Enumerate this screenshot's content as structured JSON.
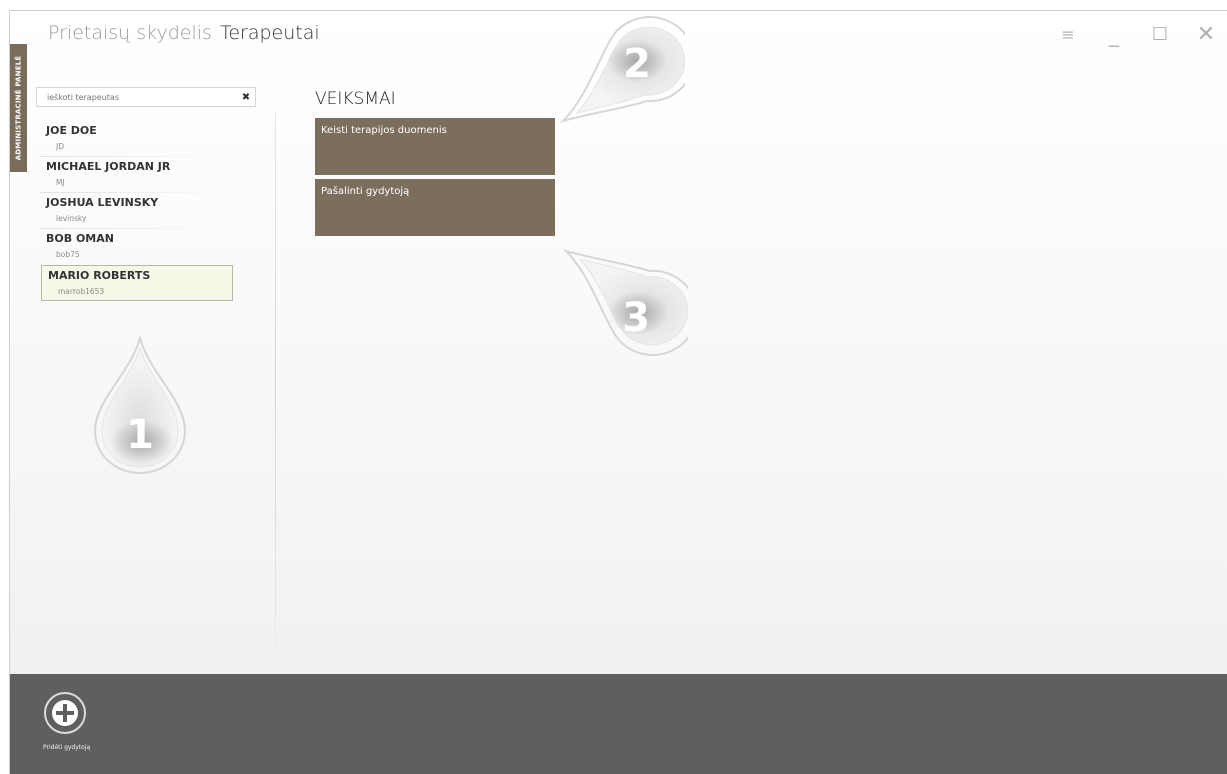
{
  "side_tab": {
    "label": "ADMINISTRACINĖ PANELĖ"
  },
  "header": {
    "breadcrumb_parent": "Prietaisų skydelis",
    "breadcrumb_current": "Terapeutai"
  },
  "window_controls": {
    "options_icon": "≡",
    "minimize_icon": "_",
    "maximize_icon": "☐",
    "close_icon": "✕"
  },
  "search": {
    "placeholder": "ieškoti terapeutas",
    "clear_icon": "✖"
  },
  "therapists": [
    {
      "name": "JOE DOE",
      "username": "JD"
    },
    {
      "name": "MICHAEL JORDAN JR",
      "username": "MJ"
    },
    {
      "name": "JOSHUA LEVINSKY",
      "username": "levinsky"
    },
    {
      "name": "BOB OMAN",
      "username": "bob75"
    },
    {
      "name": "MARIO ROBERTS",
      "username": "marrob1653"
    }
  ],
  "actions": {
    "title": "VEIKSMAI",
    "edit_label": "Keisti terapijos duomenis",
    "remove_label": "Pašalinti gydytoją"
  },
  "callouts": {
    "c1": "1",
    "c2": "2",
    "c3": "3"
  },
  "footer": {
    "add_label": "Pridėti gydytoją"
  }
}
